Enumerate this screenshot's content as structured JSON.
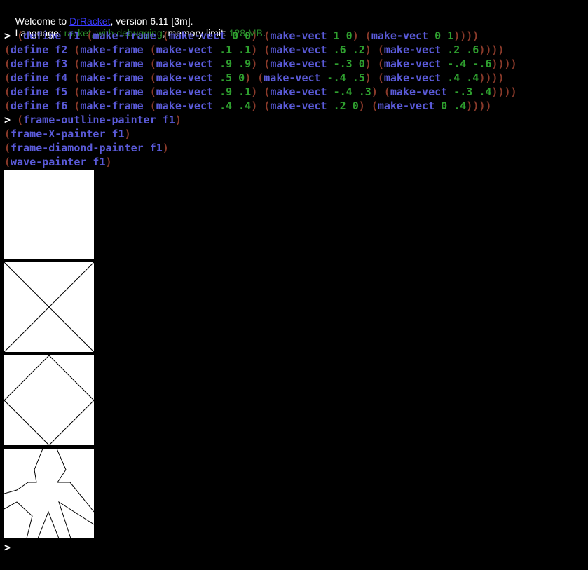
{
  "banner": {
    "welcome_prefix": "Welcome to ",
    "app_link": "DrRacket",
    "welcome_suffix": ", version 6.11 [3m].",
    "language_label": "Language: ",
    "language_value": "racket, with debugging",
    "memory_label": "; memory limit: ",
    "memory_value": "128 MB",
    "memory_suffix": "."
  },
  "prompt": ">",
  "definitions": [
    {
      "prefix": "> ",
      "name": "f1",
      "v1": "0 0",
      "v2": "1 0",
      "v3": "0 1"
    },
    {
      "prefix": "",
      "name": "f2",
      "v1": ".1 .1",
      "v2": ".6 .2",
      "v3": ".2 .6"
    },
    {
      "prefix": "",
      "name": "f3",
      "v1": ".9 .9",
      "v2": "-.3 0",
      "v3": "-.4 -.6"
    },
    {
      "prefix": "",
      "name": "f4",
      "v1": ".5 0",
      "v2": "-.4 .5",
      "v3": ".4 .4"
    },
    {
      "prefix": "",
      "name": "f5",
      "v1": ".9 .1",
      "v2": "-.4 .3",
      "v3": "-.3 .4"
    },
    {
      "prefix": "",
      "name": "f6",
      "v1": ".4 .4",
      "v2": ".2 0",
      "v3": "0 .4"
    }
  ],
  "keywords": {
    "define": "define",
    "make_frame": "make-frame",
    "make_vect": "make-vect"
  },
  "painter_calls": [
    {
      "prefix": "> ",
      "fn": "frame-outline-painter",
      "arg": "f1"
    },
    {
      "prefix": "",
      "fn": "frame-X-painter",
      "arg": "f1"
    },
    {
      "prefix": "",
      "fn": "frame-diamond-painter",
      "arg": "f1"
    },
    {
      "prefix": "",
      "fn": "wave-painter",
      "arg": "f1"
    }
  ],
  "outputs": [
    {
      "painter": "outline"
    },
    {
      "painter": "x"
    },
    {
      "painter": "diamond"
    },
    {
      "painter": "wave"
    }
  ],
  "colors": {
    "background": "#000000",
    "paren": "#8b3a2a",
    "identifier": "#5a5ad8",
    "number": "#2fa02f",
    "link": "#3a3aff",
    "language": "#2a8a2a"
  }
}
